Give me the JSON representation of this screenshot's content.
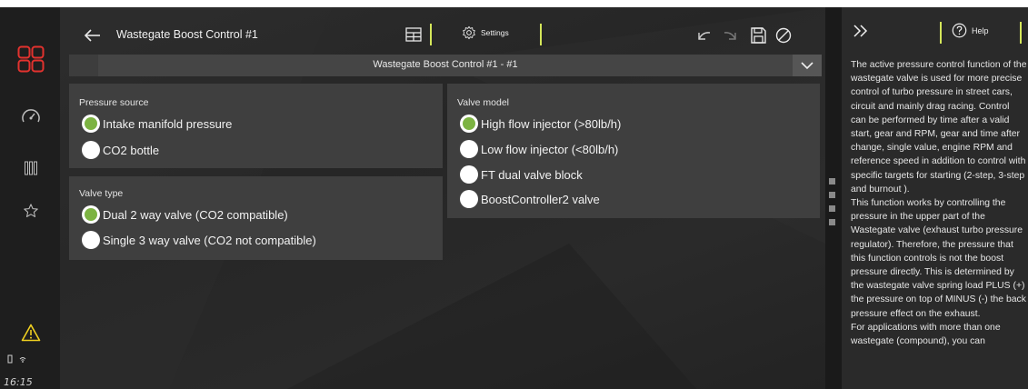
{
  "window": {
    "title": "Wastegate Boost Control #1"
  },
  "toolbar": {
    "settings_label": "Settings"
  },
  "selector": {
    "label": "Wastegate Boost Control #1 - #1"
  },
  "status": {
    "time": "16:15"
  },
  "pressure_source": {
    "title": "Pressure source",
    "options": [
      {
        "label": "Intake manifold pressure",
        "selected": true
      },
      {
        "label": "CO2 bottle",
        "selected": false
      }
    ]
  },
  "valve_type": {
    "title": "Valve type",
    "options": [
      {
        "label": "Dual 2 way valve (CO2 compatible)",
        "selected": true
      },
      {
        "label": "Single 3 way valve (CO2 not compatible)",
        "selected": false
      }
    ]
  },
  "valve_model": {
    "title": "Valve model",
    "options": [
      {
        "label": "High flow injector (>80lb/h)",
        "selected": true
      },
      {
        "label": "Low flow injector (<80lb/h)",
        "selected": false
      },
      {
        "label": "FT dual valve block",
        "selected": false
      },
      {
        "label": "BoostController2 valve",
        "selected": false
      }
    ]
  },
  "help": {
    "button_label": "Help",
    "text": "The active pressure control function of the wastegate valve is used for more precise control of turbo pressure in street cars, circuit and mainly drag racing. Control can be performed by time after a valid start, gear and RPM, gear and time after change, single value, engine RPM and reference speed in addition to control with specific targets for starting (2-step, 3-step and burnout ).\nThis function works by controlling the pressure in the upper part of the Wastegate valve (exhaust turbo pressure regulator). Therefore, the pressure that this function controls is not the boost pressure directly. This is determined by the wastegate valve spring load PLUS (+) the pressure on top of MINUS (-) the back pressure effect on the exhaust.\nFor applications with more than one wastegate (compound), you can"
  },
  "colors": {
    "accent": "#d4e65a",
    "warning": "#f0d020",
    "brand": "#e2322e",
    "radio_selected": "#7cb342"
  },
  "icons": {
    "rail": [
      "dashboard-grid-icon",
      "gauge-icon",
      "bars-icon",
      "star-icon",
      "warning-icon"
    ],
    "toolbar": [
      "back-arrow-icon",
      "table-icon",
      "settings-gear-icon",
      "undo-icon",
      "redo-icon",
      "save-icon",
      "disable-icon"
    ],
    "help": [
      "collapse-chevrons-icon",
      "help-circle-icon"
    ]
  }
}
